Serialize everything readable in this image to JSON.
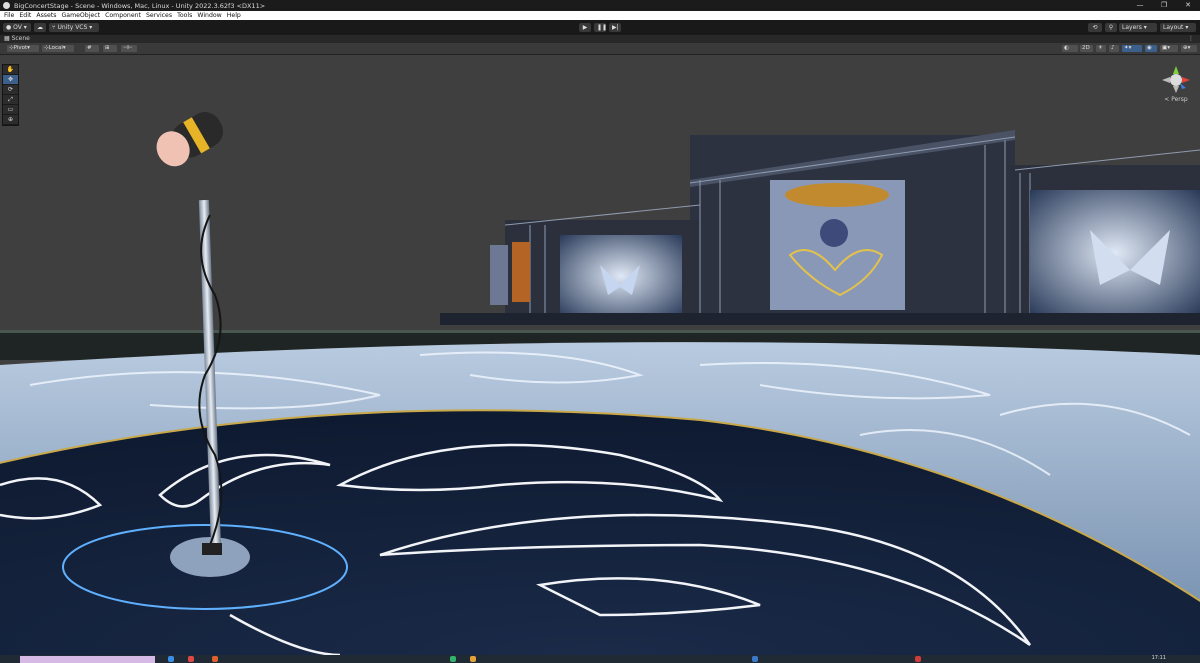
{
  "window": {
    "title": "BigConcertStage - Scene - Windows, Mac, Linux - Unity 2022.3.62f3 <DX11>",
    "controls": [
      "—",
      "❐",
      "✕"
    ]
  },
  "menu": {
    "items": [
      "File",
      "Edit",
      "Assets",
      "GameObject",
      "Component",
      "Services",
      "Tools",
      "Window",
      "Help"
    ]
  },
  "toolbar": {
    "account": "OV",
    "vcs": "Unity VCS",
    "play_icon": "play-icon",
    "pause_icon": "pause-icon",
    "step_icon": "step-icon",
    "layers": "Layers",
    "layout": "Layout"
  },
  "scene_tab": {
    "label": "Scene"
  },
  "scene_toolbar": {
    "pivot": "Pivot",
    "local": "Local",
    "mode_2d": "2D",
    "gizmo_label": "< Persp"
  },
  "tools": [
    "✋",
    "✥",
    "⟳",
    "⤢",
    "▭",
    "⊕"
  ],
  "colors": {
    "titlebar": "#1b1b1b",
    "menubar": "#ffffff",
    "viewport_bg": "#3f3f3f",
    "accent_blue": "#3d5f8c",
    "stage_floor": "#1c2c45",
    "neon": "#8fd0ff"
  },
  "taskbar": {
    "time": "17:11"
  }
}
